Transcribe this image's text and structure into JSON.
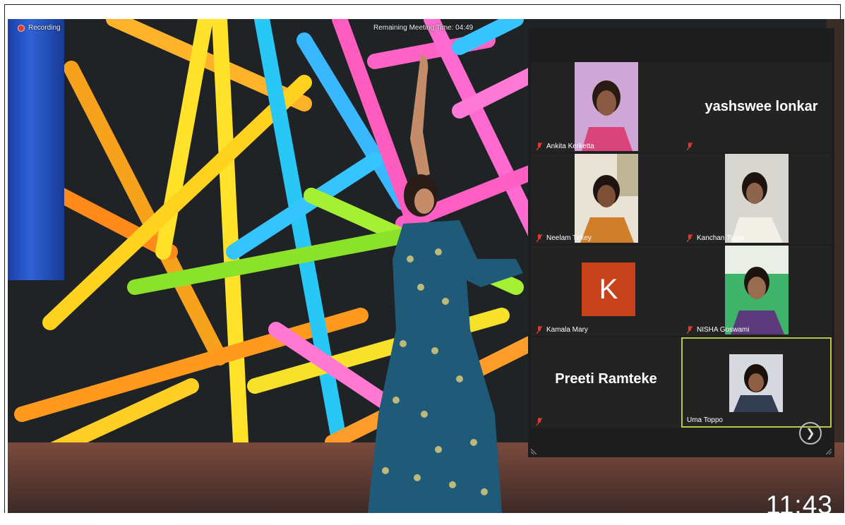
{
  "meeting": {
    "recording_label": "Recording",
    "remaining_time_label": "Remaining Meeting Time: 04:49",
    "clock": "11:43"
  },
  "gallery": {
    "participants": [
      {
        "name": "Ankita Kerketta",
        "display": "",
        "video": true
      },
      {
        "name": "",
        "display": "yashswee lonkar",
        "video": false
      },
      {
        "name": "Neelam Tirkey",
        "display": "",
        "video": true
      },
      {
        "name": "Kanchan Tigga",
        "display": "",
        "video": true
      },
      {
        "name": "Kamala Mary",
        "display": "",
        "avatar_letter": "K",
        "video": false
      },
      {
        "name": "NISHA Goswami",
        "display": "",
        "video": true
      },
      {
        "name": "",
        "display": "Preeti Ramteke",
        "video": false
      },
      {
        "name": "Uma Toppo",
        "display": "",
        "video": true,
        "active_speaker": true
      }
    ],
    "next_page_icon": "chevron-right-icon"
  },
  "colors": {
    "panel_bg": "#1d1d1d",
    "active_border": "#b7c74a",
    "avatar_k": "#c8421b",
    "muted_icon": "#e23b2e"
  }
}
